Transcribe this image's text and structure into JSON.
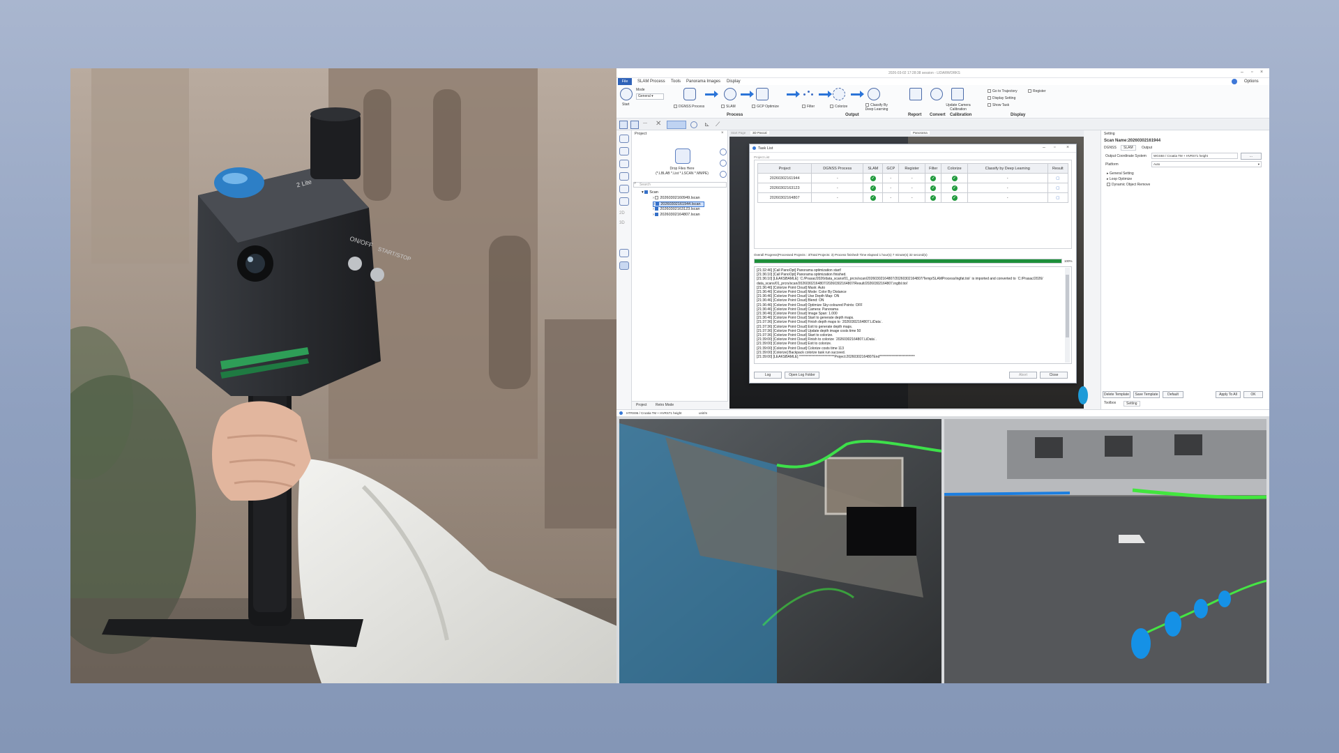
{
  "device": {
    "brand_label": "2 Lite",
    "switch_label": "ON/OFF",
    "button_label": "START/STOP"
  },
  "app": {
    "window_title": "2026-03-02 17:28:38 session - LIDARWORKS",
    "menu": [
      "File",
      "SLAM Process",
      "Tools",
      "Panorama Images",
      "Display"
    ],
    "options_label": "Options",
    "ribbon": {
      "start_label": "Start",
      "mode_label": "Mode",
      "mode_value": "General",
      "dgnss_label": "DGNSS Process",
      "slam_label": "SLAM",
      "gcp_label": "GCP Optimize",
      "filter_label": "Filter",
      "colorize_label": "Colorize",
      "classify_label": "Classify By Deep Learning",
      "report_label": "Report",
      "convert_label": "Convert",
      "update_camera_label": "Update Camera Calibration",
      "go_traj_label": "Go to Trajectory",
      "register_label": "Register",
      "display_setting_label": "Display Setting",
      "show_task_label": "Show Task",
      "groups": [
        "Process",
        "Output",
        "Report",
        "Convert",
        "Calibration",
        "Display"
      ]
    },
    "project_panel": {
      "title": "Project",
      "drop_text": "Drop Files Here",
      "drop_sub": "(*.LBLAB *.List *.LSCAN *.MMPE)",
      "search_placeholder": "Search",
      "root": "Scan",
      "items": [
        "20260302160949.lscan",
        "20260302161944.lscan",
        "20260302163123.lscan",
        "20260302164807.lscan"
      ],
      "tabs": [
        "Project",
        "Retro Mode"
      ]
    },
    "view_tabs": [
      "Start Page",
      "3D Pascal",
      "Panorama"
    ],
    "setting_panel": {
      "title": "Setting",
      "scan_name": "Scan Name:20260302161944",
      "tabs": [
        "DGNSS",
        "SLAM",
        "Output"
      ],
      "coord_label": "Output Coordinate System",
      "coord_value": "WGS84 / Croatia TM + HVRS71 height",
      "coord_btn": "...",
      "platform_label": "Platform",
      "platform_value": "Auto",
      "tree": [
        "General Setting",
        "Loop Optimize",
        "Dynamic Object Remove"
      ],
      "buttons": [
        "Delete Template",
        "Save Template",
        "Default",
        "Apply To All",
        "OK"
      ],
      "bottom_tabs": [
        "Toolbox",
        "Setting"
      ]
    },
    "status_bar": {
      "coord": "HTRS96 / Croatia TM + HVRS71 height",
      "unit": "unit/m"
    },
    "task_list": {
      "title": "Task List",
      "group_label": "Project List",
      "columns": [
        "Project",
        "DGNSS Process",
        "SLAM",
        "GCP",
        "Register",
        "Filter",
        "Colorize",
        "Classify by Deep Learning",
        "Result"
      ],
      "rows": [
        {
          "project": "20260302161944",
          "dgnss": "-",
          "slam": "✓",
          "gcp": "-",
          "register": "-",
          "filter": "✓",
          "colorize": "✓",
          "classify": "-",
          "result": "▢"
        },
        {
          "project": "20260302163123",
          "dgnss": "-",
          "slam": "✓",
          "gcp": "-",
          "register": "-",
          "filter": "✓",
          "colorize": "✓",
          "classify": "-",
          "result": "▢"
        },
        {
          "project": "20260302164807",
          "dgnss": "-",
          "slam": "✓",
          "gcp": "-",
          "register": "-",
          "filter": "✓",
          "colorize": "✓",
          "classify": "-",
          "result": "▢"
        }
      ],
      "overall_text": "Overall Progress(Processed Projects : 3/Total Projects: 3) Process finished! Time elapsed 1 hour(s) 7 minute(s) 32 second(s)",
      "progress_pct": 100,
      "progress_label": "100%",
      "log": [
        "[21:32:46] [Call PanoOpt] Panorama optimization start!",
        "[21:36:10] [Call PanoOpt] Panorama optimization finished.",
        "[21:36:10] [LEAKSBAMLE] `C:/Prasac/2026/data_scans/01_prcrs/scan/20260302164807/20260302164807/Temp/SLAMProcess/ingfat.tiol` is imported and converted to `C:/Prasac/2026/",
        "data_scans/01_prcrs/scan/20260302164807/20260302164807/Result/20260302164807.inglbl.tiol`",
        "[21:36:46] [Colorize Point Cloud] Mask: Auto",
        "[21:36:46] [Colorize Point Cloud] Mode: Color By Distance",
        "[21:36:46] [Colorize Point Cloud] Use Depth Map: ON",
        "[21:36:46] [Colorize Point Cloud] Blend: ON",
        "[21:36:46] [Colorize Point Cloud] Optimize Sky-coloured Points: OFF",
        "[21:36:46] [Colorize Point Cloud] Camera: Panorama",
        "[21:36:46] [Colorize Point Cloud] Image Span: 1.000",
        "[21:36:46] [Colorize Point Cloud] Start to generate depth maps.",
        "[21:37:36] [Colorize Point Cloud] Finish depth maps to `20260302164807.LiData`.",
        "[21:37:36] [Colorize Point Cloud] Exit to generate depth maps.",
        "[21:37:36] [Colorize Point Cloud] Update depth image costs time 50",
        "[21:37:36] [Colorize Point Cloud] Start to colorize.",
        "[21:39:00] [Colorize Point Cloud] Finish to colorize `20260302164807.LiData`.",
        "[21:39:00] [Colorize Point Cloud] Exit to colorize.",
        "[21:39:00] [Colorize Point Cloud] Colorize costs time 113",
        "[21:39:00] [Colorize] Backpack colorize task run succeed.",
        "[21:39:00] [LEAKSBAMLE] **************************Project:20260302164807End**************************"
      ],
      "buttons": [
        "Log",
        "Open Log Folder",
        "Abort",
        "Close"
      ]
    }
  }
}
